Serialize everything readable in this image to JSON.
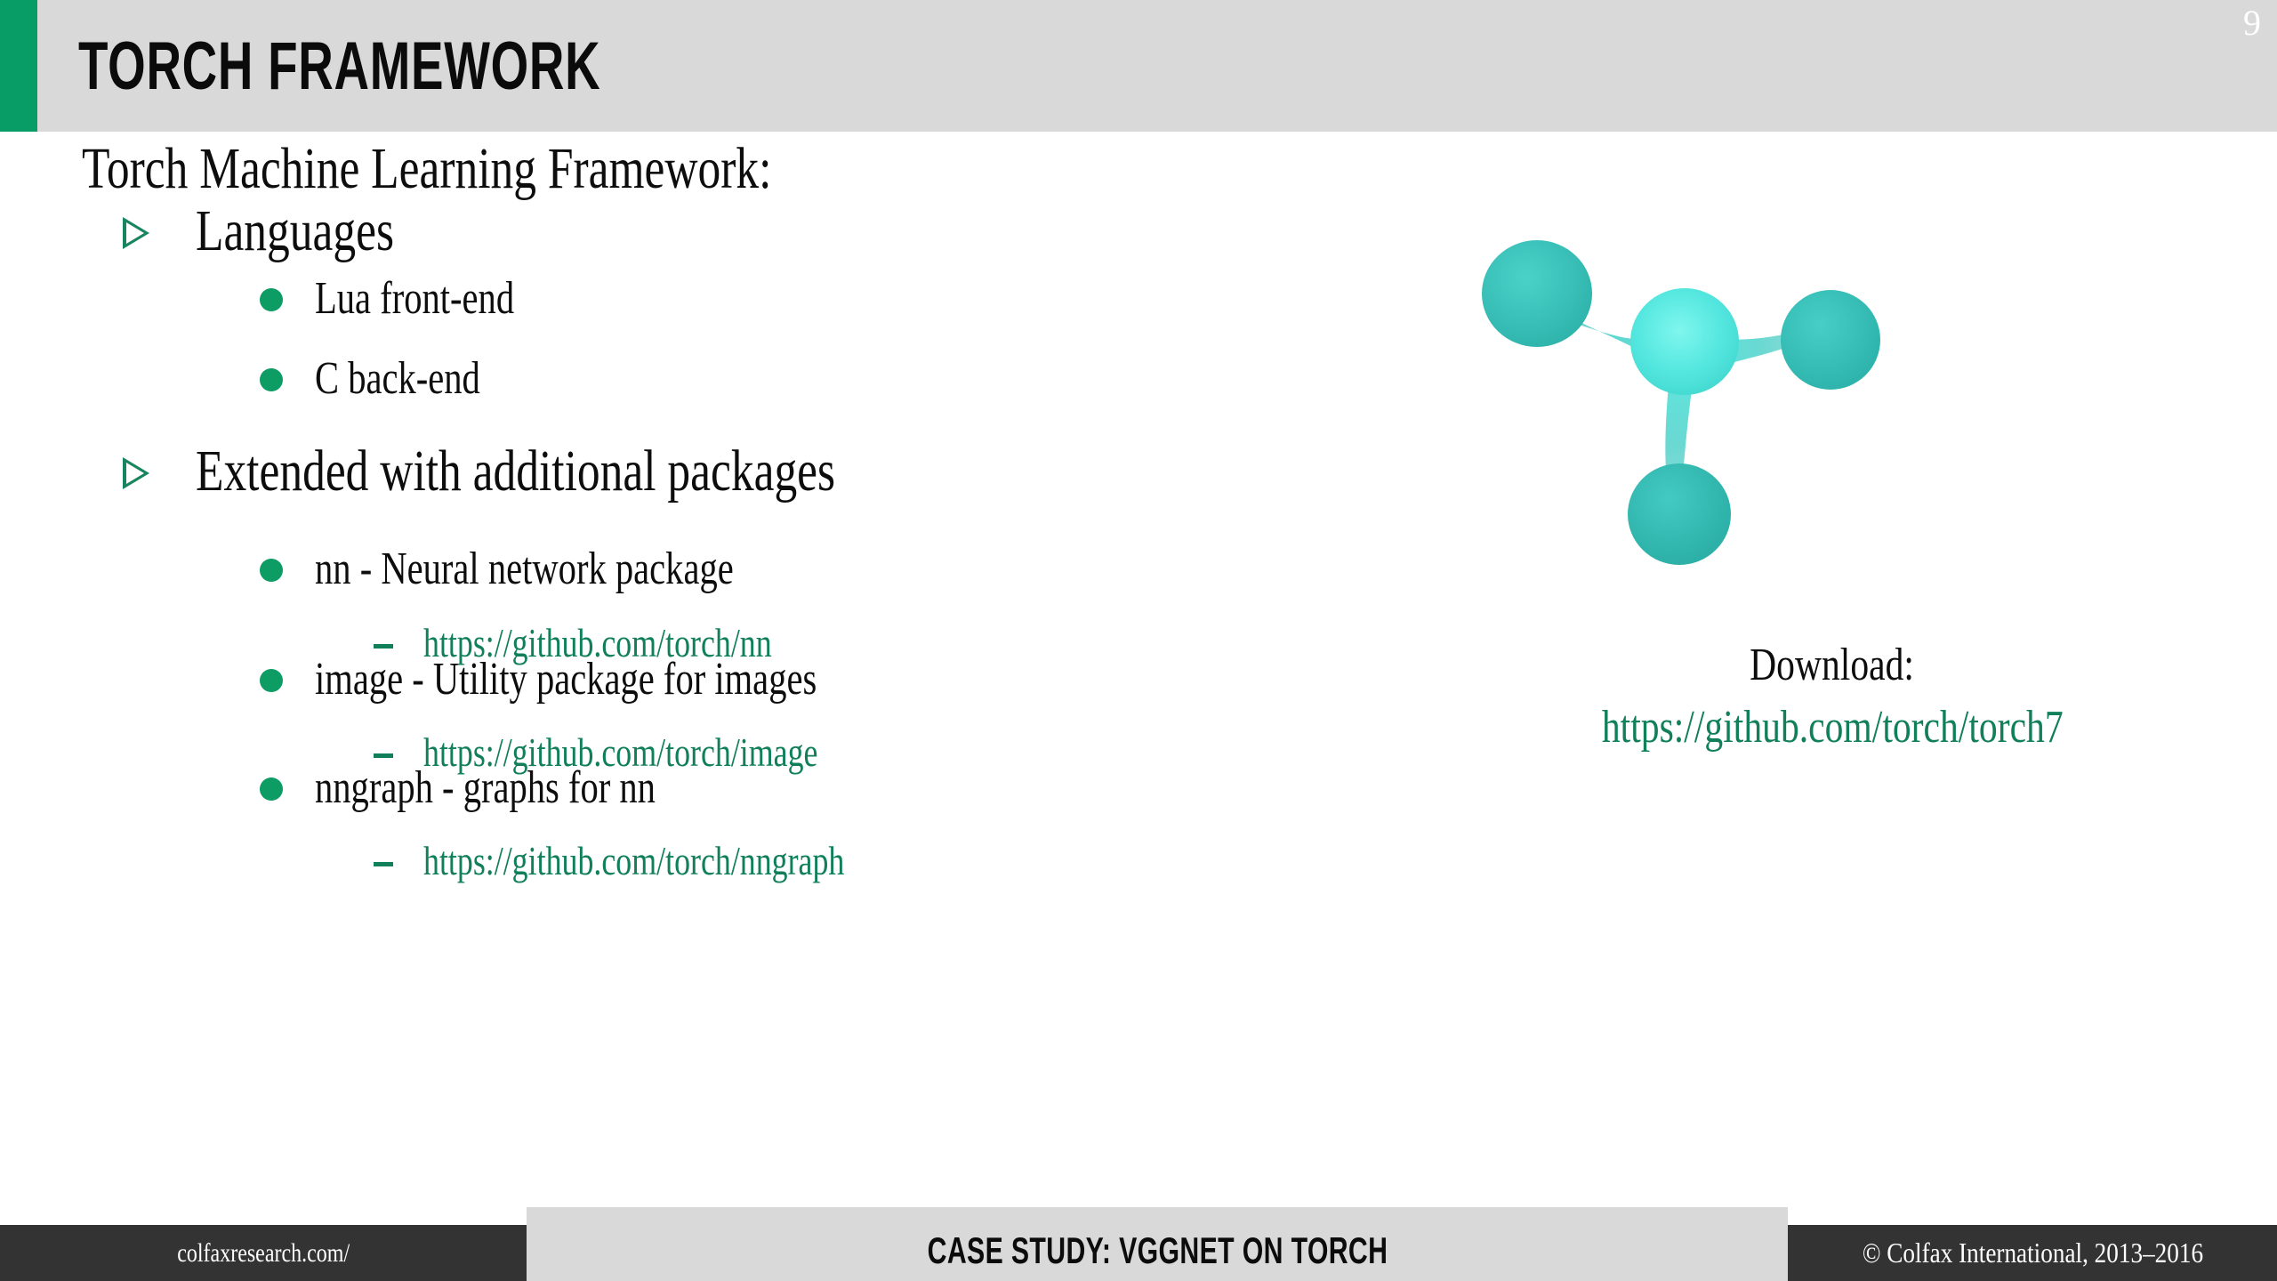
{
  "slide": {
    "title": "TORCH FRAMEWORK",
    "page_number": "9",
    "accent_green": "#089c67",
    "header_bg": "#d9d9d9",
    "link_green": "#11805a",
    "bullet_green": "#0d9c63",
    "footer_dark": "#333333"
  },
  "body": {
    "intro": "Torch Machine Learning Framework:",
    "sections": [
      {
        "heading": "Languages",
        "items": [
          {
            "text": "Lua front-end",
            "link": null
          },
          {
            "text": "C back-end",
            "link": null
          }
        ]
      },
      {
        "heading": "Extended with additional packages",
        "items": [
          {
            "text": "nn - Neural network package",
            "link": "https://github.com/torch/nn"
          },
          {
            "text": "image - Utility package for images",
            "link": "https://github.com/torch/image"
          },
          {
            "text": "nngraph - graphs for nn",
            "link": "https://github.com/torch/nngraph"
          }
        ]
      }
    ]
  },
  "aside": {
    "logo_name": "torch-logo",
    "logo_colors": {
      "center": "#5ef0e6",
      "node": "#35bdb6",
      "node_dark": "#2eb3ac"
    },
    "download_label": "Download:",
    "download_link": "https://github.com/torch/torch7"
  },
  "footer": {
    "left": "colfaxresearch.com/",
    "center": "CASE STUDY: VGGNET ON TORCH",
    "right": "© Colfax International, 2013–2016"
  }
}
